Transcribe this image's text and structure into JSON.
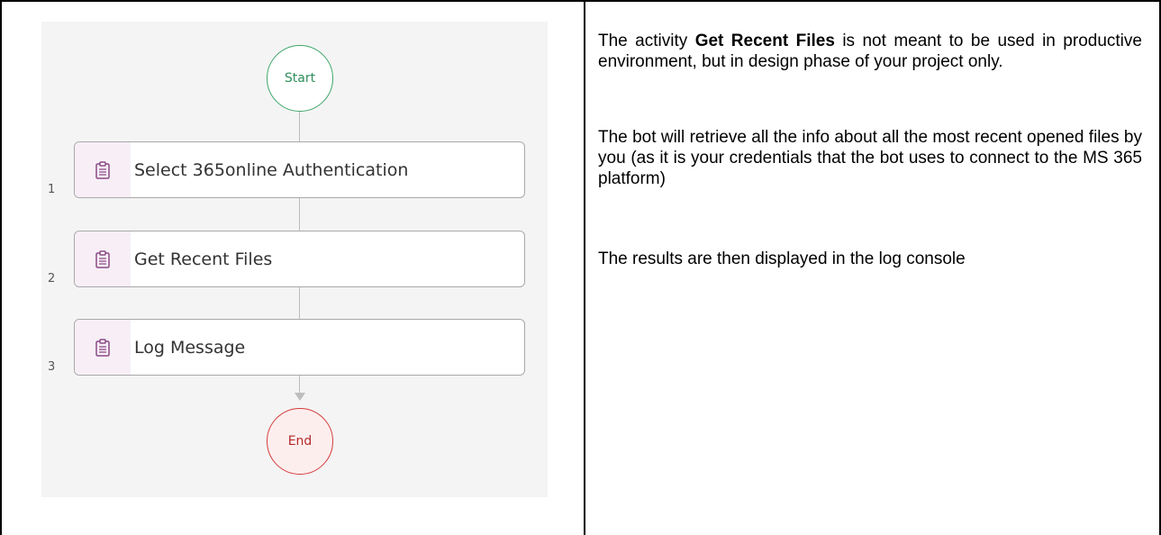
{
  "diagram": {
    "start_label": "Start",
    "end_label": "End",
    "steps": [
      {
        "number": "1",
        "label": "Select 365online Authentication",
        "icon": "clipboard-icon"
      },
      {
        "number": "2",
        "label": "Get Recent Files",
        "icon": "clipboard-icon"
      },
      {
        "number": "3",
        "label": "Log Message",
        "icon": "clipboard-icon"
      }
    ],
    "colors": {
      "start_border": "#3fa66a",
      "end_border": "#d43c3c",
      "end_fill": "#fdeeee",
      "icon_cell": "#f7eef6",
      "icon": "#8a4a86"
    }
  },
  "description": {
    "p1_before": "The activity ",
    "p1_bold": "Get Recent Files",
    "p1_after": " is not meant to be used in productive environment, but in design phase of your project only.",
    "p2": "The bot will retrieve all the info about all the most recent opened files by you (as it is your credentials that the bot uses to connect to the MS 365 platform)",
    "p3": "The results are then displayed in the log console"
  }
}
